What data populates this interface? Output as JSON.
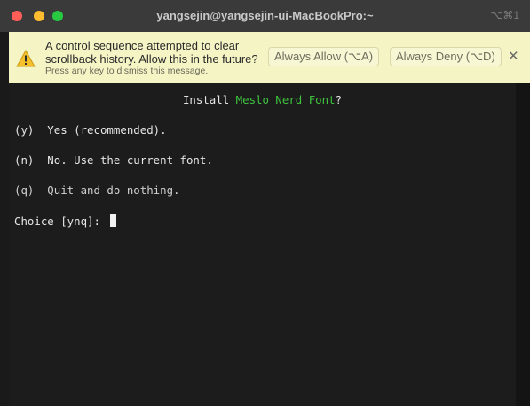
{
  "window": {
    "title": "yangsejin@yangsejin-ui-MacBookPro:~",
    "shortcut": "⌥⌘1"
  },
  "banner": {
    "line1": "A control sequence attempted to clear",
    "line2": "scrollback history. Allow this in the future?",
    "hint": "Press any key to dismiss this message.",
    "allow_label": "Always Allow (⌥A)",
    "deny_label": "Always Deny (⌥D)",
    "close_symbol": "✕",
    "icon": "warning-icon",
    "background": "#f5f4c5"
  },
  "terminal": {
    "prompt_prefix": "Install ",
    "prompt_font": "Meslo Nerd Font",
    "prompt_suffix": "?",
    "option_yes": "(y)  Yes (recommended).",
    "option_no": "(n)  No. Use the current font.",
    "option_quit": "(q)  Quit and do nothing.",
    "choice_prompt": "Choice [ynq]: ",
    "accent_color": "#3ec43e"
  }
}
